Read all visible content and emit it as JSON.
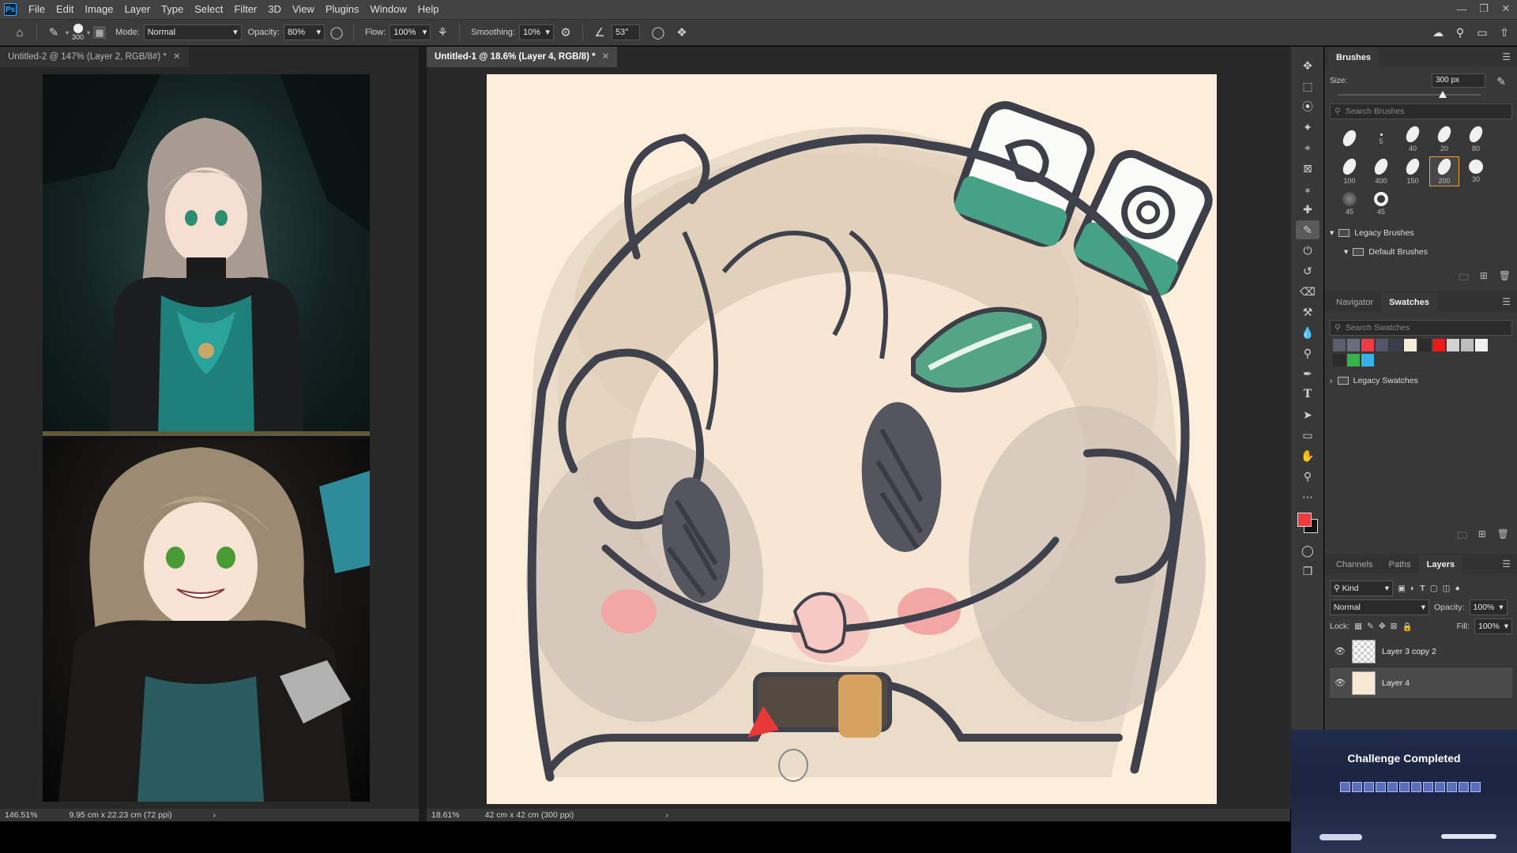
{
  "menu": [
    "File",
    "Edit",
    "Image",
    "Layer",
    "Type",
    "Select",
    "Filter",
    "3D",
    "View",
    "Plugins",
    "Window",
    "Help"
  ],
  "options": {
    "brush_size": "300",
    "mode_label": "Mode:",
    "mode_value": "Normal",
    "opacity_label": "Opacity:",
    "opacity_value": "80%",
    "flow_label": "Flow:",
    "flow_value": "100%",
    "smoothing_label": "Smoothing:",
    "smoothing_value": "10%",
    "angle_value": "53°"
  },
  "docs": {
    "left_tab": "Untitled-2 @ 147% (Layer 2, RGB/8#) *",
    "center_tab": "Untitled-1 @ 18.6% (Layer 4, RGB/8) *",
    "left_zoom": "146.51%",
    "left_size": "9.95 cm x 22.23 cm (72 ppi)",
    "center_zoom": "18.61%",
    "center_size": "42 cm x 42 cm (300 ppi)"
  },
  "brushes": {
    "tab": "Brushes",
    "size_label": "Size:",
    "size_value": "300 px",
    "search_placeholder": "Search Brushes",
    "presets": [
      "",
      "5",
      "40",
      "20",
      "80",
      "100",
      "400",
      "150",
      "200",
      "30",
      "45",
      "45"
    ],
    "legacy_folder": "Legacy Brushes",
    "default_folder": "Default Brushes"
  },
  "swatches": {
    "tabs": [
      "Navigator",
      "Swatches"
    ],
    "search_placeholder": "Search Swatches",
    "row1": [
      "#5b5e6b",
      "#6a6d7a",
      "#ee3b46",
      "#53566a",
      "#3c3d4a",
      "#f6ecd8",
      "#2b2b2b",
      "#e81a1a",
      "#d2d2d2",
      "#bdbdbd",
      "#f0f0f0"
    ],
    "row2": [
      "#2a2a2a",
      "#37b24d",
      "#36b0e8"
    ],
    "legacy_folder": "Legacy Swatches"
  },
  "layers": {
    "tabs": [
      "Channels",
      "Paths",
      "Layers"
    ],
    "kind_label": "Kind",
    "blend_mode": "Normal",
    "opacity_label": "Opacity:",
    "opacity_value": "100%",
    "lock_label": "Lock:",
    "fill_label": "Fill:",
    "fill_value": "100%",
    "items": [
      "Layer 3 copy 2",
      "Layer 4"
    ]
  },
  "notification": {
    "title": "Challenge Completed"
  },
  "colors": {
    "foreground": "#ef3b3f",
    "background": "#111111",
    "accent": "#e8a02a"
  }
}
